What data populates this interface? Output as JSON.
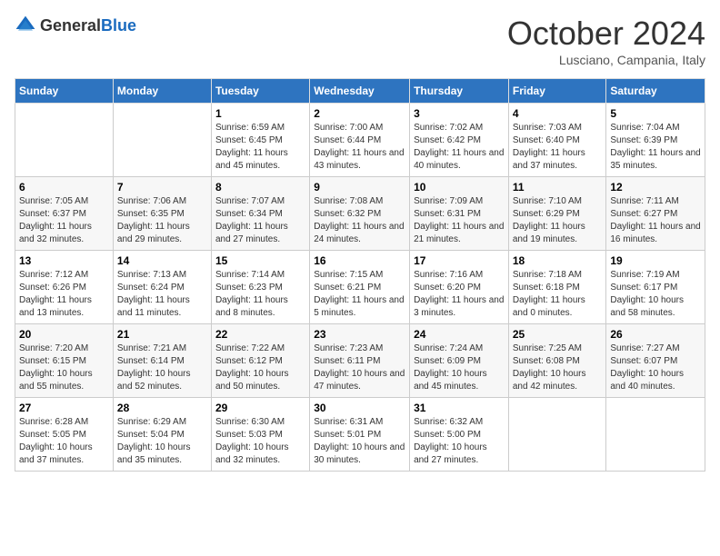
{
  "logo": {
    "general": "General",
    "blue": "Blue"
  },
  "header": {
    "month": "October 2024",
    "location": "Lusciano, Campania, Italy"
  },
  "weekdays": [
    "Sunday",
    "Monday",
    "Tuesday",
    "Wednesday",
    "Thursday",
    "Friday",
    "Saturday"
  ],
  "weeks": [
    [
      {
        "day": "",
        "sunrise": "",
        "sunset": "",
        "daylight": ""
      },
      {
        "day": "",
        "sunrise": "",
        "sunset": "",
        "daylight": ""
      },
      {
        "day": "1",
        "sunrise": "Sunrise: 6:59 AM",
        "sunset": "Sunset: 6:45 PM",
        "daylight": "Daylight: 11 hours and 45 minutes."
      },
      {
        "day": "2",
        "sunrise": "Sunrise: 7:00 AM",
        "sunset": "Sunset: 6:44 PM",
        "daylight": "Daylight: 11 hours and 43 minutes."
      },
      {
        "day": "3",
        "sunrise": "Sunrise: 7:02 AM",
        "sunset": "Sunset: 6:42 PM",
        "daylight": "Daylight: 11 hours and 40 minutes."
      },
      {
        "day": "4",
        "sunrise": "Sunrise: 7:03 AM",
        "sunset": "Sunset: 6:40 PM",
        "daylight": "Daylight: 11 hours and 37 minutes."
      },
      {
        "day": "5",
        "sunrise": "Sunrise: 7:04 AM",
        "sunset": "Sunset: 6:39 PM",
        "daylight": "Daylight: 11 hours and 35 minutes."
      }
    ],
    [
      {
        "day": "6",
        "sunrise": "Sunrise: 7:05 AM",
        "sunset": "Sunset: 6:37 PM",
        "daylight": "Daylight: 11 hours and 32 minutes."
      },
      {
        "day": "7",
        "sunrise": "Sunrise: 7:06 AM",
        "sunset": "Sunset: 6:35 PM",
        "daylight": "Daylight: 11 hours and 29 minutes."
      },
      {
        "day": "8",
        "sunrise": "Sunrise: 7:07 AM",
        "sunset": "Sunset: 6:34 PM",
        "daylight": "Daylight: 11 hours and 27 minutes."
      },
      {
        "day": "9",
        "sunrise": "Sunrise: 7:08 AM",
        "sunset": "Sunset: 6:32 PM",
        "daylight": "Daylight: 11 hours and 24 minutes."
      },
      {
        "day": "10",
        "sunrise": "Sunrise: 7:09 AM",
        "sunset": "Sunset: 6:31 PM",
        "daylight": "Daylight: 11 hours and 21 minutes."
      },
      {
        "day": "11",
        "sunrise": "Sunrise: 7:10 AM",
        "sunset": "Sunset: 6:29 PM",
        "daylight": "Daylight: 11 hours and 19 minutes."
      },
      {
        "day": "12",
        "sunrise": "Sunrise: 7:11 AM",
        "sunset": "Sunset: 6:27 PM",
        "daylight": "Daylight: 11 hours and 16 minutes."
      }
    ],
    [
      {
        "day": "13",
        "sunrise": "Sunrise: 7:12 AM",
        "sunset": "Sunset: 6:26 PM",
        "daylight": "Daylight: 11 hours and 13 minutes."
      },
      {
        "day": "14",
        "sunrise": "Sunrise: 7:13 AM",
        "sunset": "Sunset: 6:24 PM",
        "daylight": "Daylight: 11 hours and 11 minutes."
      },
      {
        "day": "15",
        "sunrise": "Sunrise: 7:14 AM",
        "sunset": "Sunset: 6:23 PM",
        "daylight": "Daylight: 11 hours and 8 minutes."
      },
      {
        "day": "16",
        "sunrise": "Sunrise: 7:15 AM",
        "sunset": "Sunset: 6:21 PM",
        "daylight": "Daylight: 11 hours and 5 minutes."
      },
      {
        "day": "17",
        "sunrise": "Sunrise: 7:16 AM",
        "sunset": "Sunset: 6:20 PM",
        "daylight": "Daylight: 11 hours and 3 minutes."
      },
      {
        "day": "18",
        "sunrise": "Sunrise: 7:18 AM",
        "sunset": "Sunset: 6:18 PM",
        "daylight": "Daylight: 11 hours and 0 minutes."
      },
      {
        "day": "19",
        "sunrise": "Sunrise: 7:19 AM",
        "sunset": "Sunset: 6:17 PM",
        "daylight": "Daylight: 10 hours and 58 minutes."
      }
    ],
    [
      {
        "day": "20",
        "sunrise": "Sunrise: 7:20 AM",
        "sunset": "Sunset: 6:15 PM",
        "daylight": "Daylight: 10 hours and 55 minutes."
      },
      {
        "day": "21",
        "sunrise": "Sunrise: 7:21 AM",
        "sunset": "Sunset: 6:14 PM",
        "daylight": "Daylight: 10 hours and 52 minutes."
      },
      {
        "day": "22",
        "sunrise": "Sunrise: 7:22 AM",
        "sunset": "Sunset: 6:12 PM",
        "daylight": "Daylight: 10 hours and 50 minutes."
      },
      {
        "day": "23",
        "sunrise": "Sunrise: 7:23 AM",
        "sunset": "Sunset: 6:11 PM",
        "daylight": "Daylight: 10 hours and 47 minutes."
      },
      {
        "day": "24",
        "sunrise": "Sunrise: 7:24 AM",
        "sunset": "Sunset: 6:09 PM",
        "daylight": "Daylight: 10 hours and 45 minutes."
      },
      {
        "day": "25",
        "sunrise": "Sunrise: 7:25 AM",
        "sunset": "Sunset: 6:08 PM",
        "daylight": "Daylight: 10 hours and 42 minutes."
      },
      {
        "day": "26",
        "sunrise": "Sunrise: 7:27 AM",
        "sunset": "Sunset: 6:07 PM",
        "daylight": "Daylight: 10 hours and 40 minutes."
      }
    ],
    [
      {
        "day": "27",
        "sunrise": "Sunrise: 6:28 AM",
        "sunset": "Sunset: 5:05 PM",
        "daylight": "Daylight: 10 hours and 37 minutes."
      },
      {
        "day": "28",
        "sunrise": "Sunrise: 6:29 AM",
        "sunset": "Sunset: 5:04 PM",
        "daylight": "Daylight: 10 hours and 35 minutes."
      },
      {
        "day": "29",
        "sunrise": "Sunrise: 6:30 AM",
        "sunset": "Sunset: 5:03 PM",
        "daylight": "Daylight: 10 hours and 32 minutes."
      },
      {
        "day": "30",
        "sunrise": "Sunrise: 6:31 AM",
        "sunset": "Sunset: 5:01 PM",
        "daylight": "Daylight: 10 hours and 30 minutes."
      },
      {
        "day": "31",
        "sunrise": "Sunrise: 6:32 AM",
        "sunset": "Sunset: 5:00 PM",
        "daylight": "Daylight: 10 hours and 27 minutes."
      },
      {
        "day": "",
        "sunrise": "",
        "sunset": "",
        "daylight": ""
      },
      {
        "day": "",
        "sunrise": "",
        "sunset": "",
        "daylight": ""
      }
    ]
  ]
}
